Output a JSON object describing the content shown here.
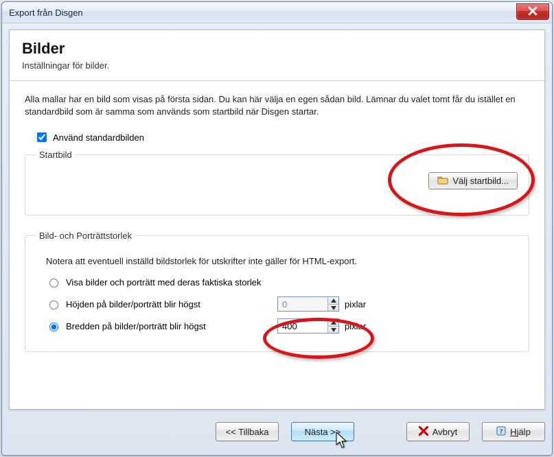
{
  "window": {
    "title": "Export från Disgen"
  },
  "header": {
    "title": "Bilder",
    "subtitle": "Inställningar för bilder."
  },
  "intro": "Alla mallar har en bild som visas på första sidan. Du kan här välja en egen sådan bild. Lämnar du valet tomt får du istället en standardbild som är samma som används som startbild när Disgen startar.",
  "use_default": {
    "label": "Använd standardbilden",
    "checked": true
  },
  "startbild": {
    "legend": "Startbild",
    "choose_label": "Välj startbild..."
  },
  "size": {
    "legend": "Bild- och Porträttstorlek",
    "note": "Notera att eventuell inställd bildstorlek för utskrifter inte gäller för HTML-export.",
    "opt_actual": "Visa bilder och porträtt med deras faktiska storlek",
    "opt_height": "Höjden på bilder/porträtt blir högst",
    "opt_width": "Bredden på bilder/porträtt blir högst",
    "height_value": "0",
    "width_value": "400",
    "unit": "pixlar",
    "selected": "width"
  },
  "buttons": {
    "back": "<< Tillbaka",
    "next": "Nästa >>",
    "cancel": "Avbryt",
    "help_prefix": "H",
    "help_rest": "jälp"
  }
}
